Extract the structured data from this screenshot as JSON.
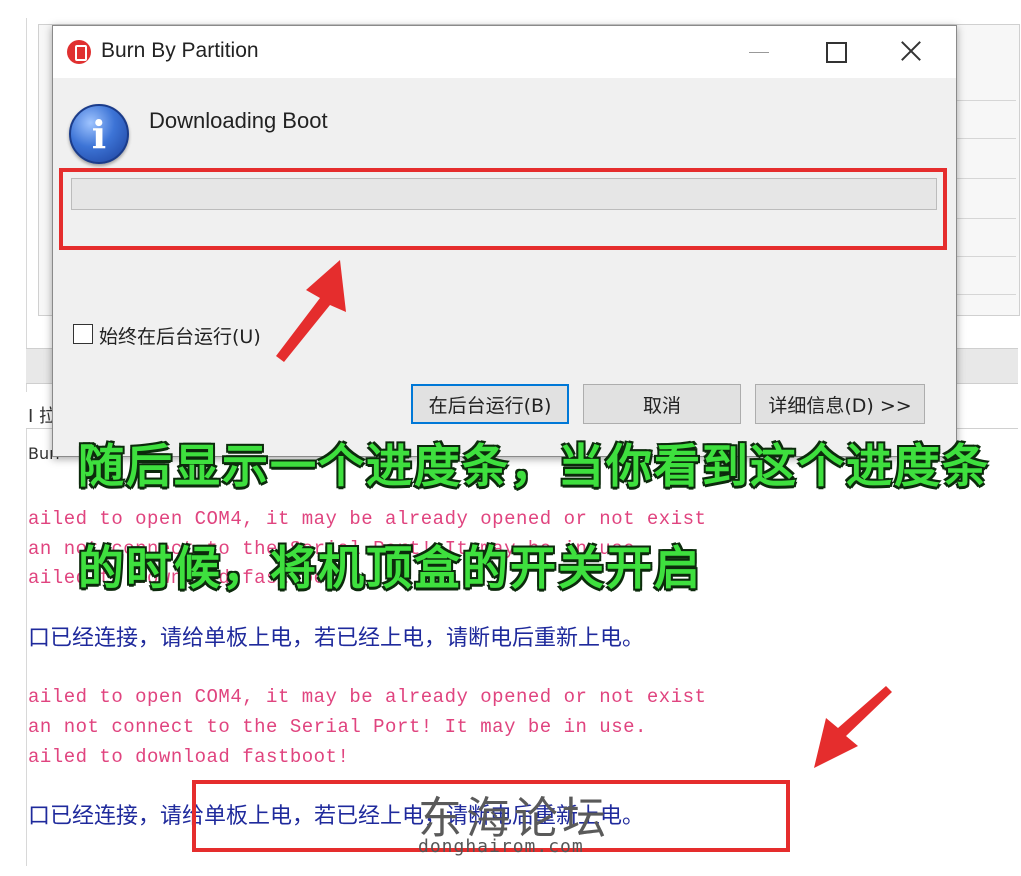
{
  "background": {
    "tab_text": "I 拉",
    "label_text": "Burr",
    "log_lines": [
      {
        "kind": "err",
        "text": "ailed to open COM4, it may be already opened or not exist"
      },
      {
        "kind": "err",
        "text": "an not connect to the Serial Port! It may be in use."
      },
      {
        "kind": "err",
        "text": "ailed to download fastboot!"
      },
      {
        "kind": "info",
        "text": "口已经连接，请给单板上电，若已经上电，请断电后重新上电。"
      },
      {
        "kind": "err",
        "text": "ailed to open COM4, it may be already opened or not exist"
      },
      {
        "kind": "err",
        "text": "an not connect to the Serial Port! It may be in use."
      },
      {
        "kind": "err",
        "text": "ailed to download fastboot!"
      },
      {
        "kind": "info",
        "text": "口已经连接，请给单板上电，若已经上电，请断电后重新上电。"
      }
    ]
  },
  "dialog": {
    "title": "Burn By Partition",
    "status": "Downloading Boot",
    "progress": 0,
    "checkbox_label": "始终在后台运行(U)",
    "checkbox_checked": false,
    "buttons": {
      "background": "在后台运行(B)",
      "cancel": "取消",
      "details": "详细信息(D) >>"
    }
  },
  "annotation": {
    "line1": "随后显示一个进度条，当你看到这个进度条",
    "line2": "的时候，将机顶盒的开关开启"
  },
  "watermark": {
    "title": "东海论坛",
    "url": "donghairom.com"
  },
  "colors": {
    "highlight_red": "#e52d2d",
    "annotation_green": "#3ee03e",
    "error_pink": "#e0447f",
    "info_blue": "#1f2a9c",
    "focus_blue": "#0078d7"
  }
}
